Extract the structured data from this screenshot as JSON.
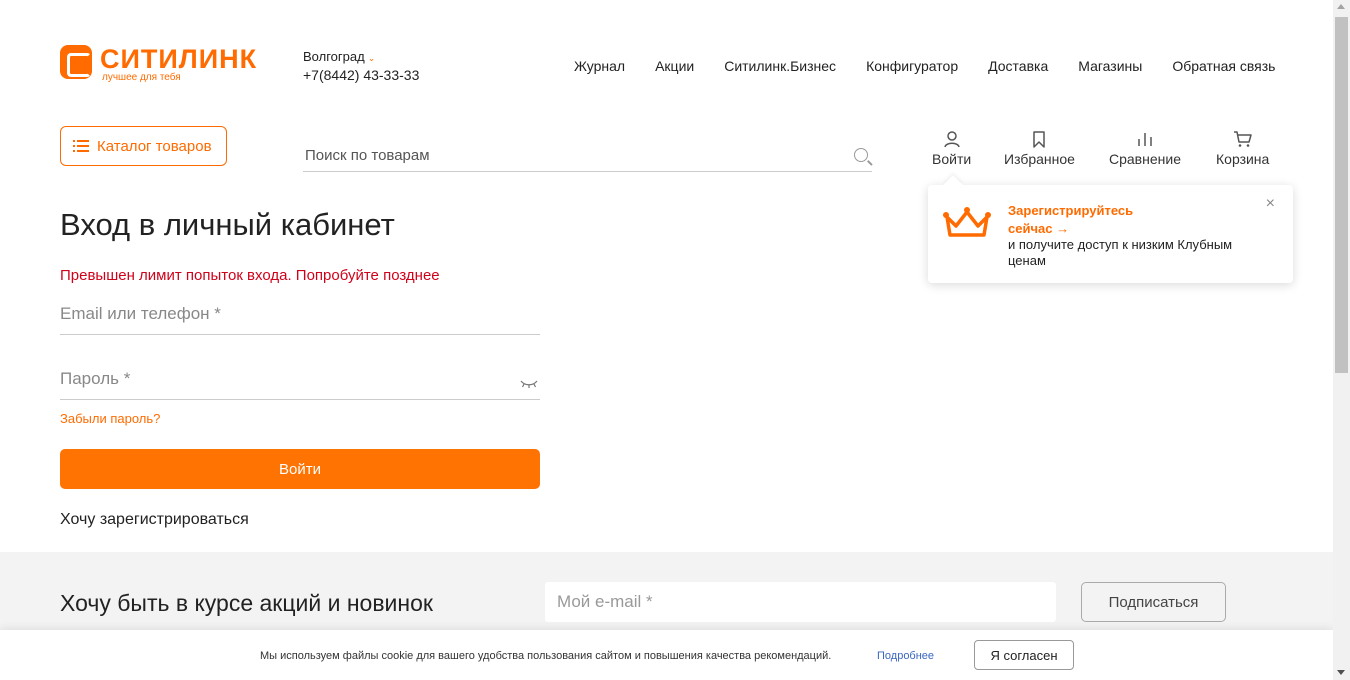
{
  "header": {
    "logo_name": "СИТИЛИНК",
    "logo_slogan": "лучшее для тебя",
    "city": "Волгоград",
    "phone": "+7(8442) 43-33-33",
    "nav": [
      "Журнал",
      "Акции",
      "Ситилинк.Бизнес",
      "Конфигуратор",
      "Доставка",
      "Магазины",
      "Обратная связь"
    ]
  },
  "catalog": {
    "label": "Каталог товаров"
  },
  "search": {
    "placeholder": "Поиск по товарам"
  },
  "actions": {
    "login": "Войти",
    "favorites": "Избранное",
    "compare": "Сравнение",
    "cart": "Корзина"
  },
  "popup": {
    "register_link": "Зарегистрируйтесь сейчас →",
    "description": "и получите доступ к низким Клубным ценам",
    "close": "×"
  },
  "login": {
    "title": "Вход в личный кабинет",
    "error": "Превышен лимит попыток входа. Попробуйте позднее",
    "email_placeholder": "Email или телефон *",
    "password_placeholder": "Пароль *",
    "forgot": "Забыли пароль?",
    "submit": "Войти",
    "register": "Хочу зарегистрироваться"
  },
  "subscribe": {
    "title": "Хочу быть в курсе акций и новинок",
    "email_placeholder": "Мой e-mail *",
    "button": "Подписаться"
  },
  "cookie": {
    "text": "Мы используем файлы cookie для вашего удобства пользования сайтом и повышения качества рекомендаций.",
    "more": "Подробнее",
    "accept": "Я согласен"
  },
  "colors": {
    "accent": "#ff6b00",
    "error": "#d0021b",
    "link": "#3a67c1"
  }
}
